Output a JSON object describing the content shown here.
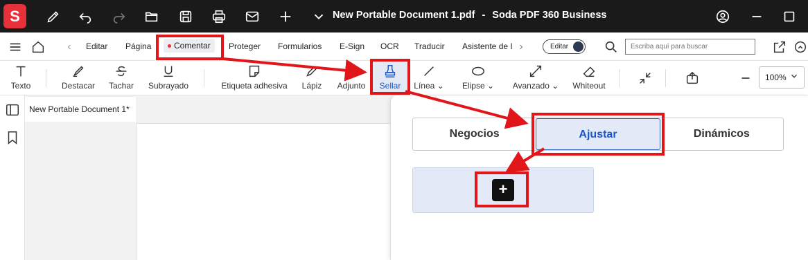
{
  "app": {
    "logo_letter": "S",
    "document_name": "New Portable Document 1.pdf",
    "separator": "-",
    "product_name": "Soda PDF 360 Business",
    "brand_color": "#e8303a"
  },
  "titlebar_icons": [
    "pen-icon",
    "undo-icon",
    "redo-icon",
    "open-folder-icon",
    "save-icon",
    "print-icon",
    "mail-icon",
    "new-icon",
    "chevron-down-icon",
    "account-icon",
    "minimize-icon",
    "maximize-icon"
  ],
  "menu": {
    "items": [
      "Editar",
      "Página",
      "Comentar",
      "Proteger",
      "Formularios",
      "E-Sign",
      "OCR",
      "Traducir",
      "Asistente de I"
    ],
    "active": "Comentar",
    "edit_toggle_label": "Editar",
    "search_placeholder": "Escriba aquí para buscar"
  },
  "tools": {
    "items": [
      {
        "label": "Texto",
        "icon": "text-icon"
      },
      {
        "label": "Destacar",
        "icon": "highlighter-icon"
      },
      {
        "label": "Tachar",
        "icon": "strikethrough-icon"
      },
      {
        "label": "Subrayado",
        "icon": "underline-icon"
      },
      {
        "label": "Etiqueta adhesiva",
        "icon": "sticky-note-icon"
      },
      {
        "label": "Lápiz",
        "icon": "pencil-icon"
      },
      {
        "label": "Adjunto",
        "icon": "paperclip-icon"
      },
      {
        "label": "Sellar",
        "icon": "stamp-icon"
      },
      {
        "label": "Línea",
        "icon": "line-icon"
      },
      {
        "label": "Elipse",
        "icon": "ellipse-icon"
      },
      {
        "label": "Avanzado",
        "icon": "arrows-icon"
      },
      {
        "label": "Whiteout",
        "icon": "eraser-icon"
      }
    ],
    "active": "Sellar",
    "zoom": "100%"
  },
  "document": {
    "tab_title": "New Portable Document 1*"
  },
  "stamp_panel": {
    "tabs": [
      "Negocios",
      "Ajustar",
      "Dinámicos"
    ],
    "selected_tab": "Ajustar",
    "add_label": "+"
  },
  "colors": {
    "accent": "#1a56c4",
    "annotation": "#e0161b",
    "titlebar": "#1a1a1a"
  }
}
